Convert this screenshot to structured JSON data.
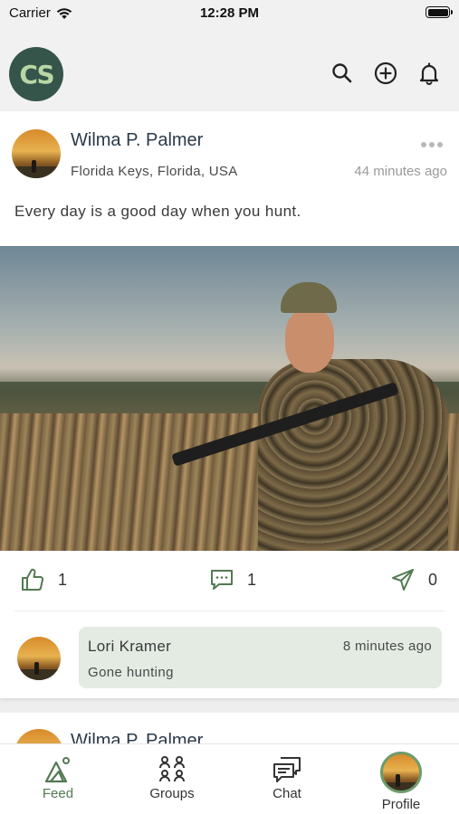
{
  "status_bar": {
    "carrier": "Carrier",
    "time": "12:28 PM"
  },
  "header": {
    "logo_text": "CS",
    "icons": [
      "search-icon",
      "add-circle-icon",
      "bell-icon"
    ]
  },
  "post": {
    "author": "Wilma P. Palmer",
    "location": "Florida Keys, Florida, USA",
    "time": "44 minutes ago",
    "text": "Every day is a good day when you hunt.",
    "likes": "1",
    "comments": "1",
    "shares": "0",
    "comment": {
      "author": "Lori Kramer",
      "time": "8 minutes ago",
      "text": "Gone hunting"
    }
  },
  "next_post": {
    "author": "Wilma P. Palmer"
  },
  "tabs": [
    {
      "label": "Feed",
      "icon": "feed-icon",
      "active": true
    },
    {
      "label": "Groups",
      "icon": "groups-icon",
      "active": false
    },
    {
      "label": "Chat",
      "icon": "chat-icon",
      "active": false
    },
    {
      "label": "Profile",
      "icon": "profile-avatar",
      "active": false
    }
  ],
  "colors": {
    "accent": "#527a52",
    "logo_bg": "#35554a",
    "comment_bg": "#e3ebe3"
  }
}
